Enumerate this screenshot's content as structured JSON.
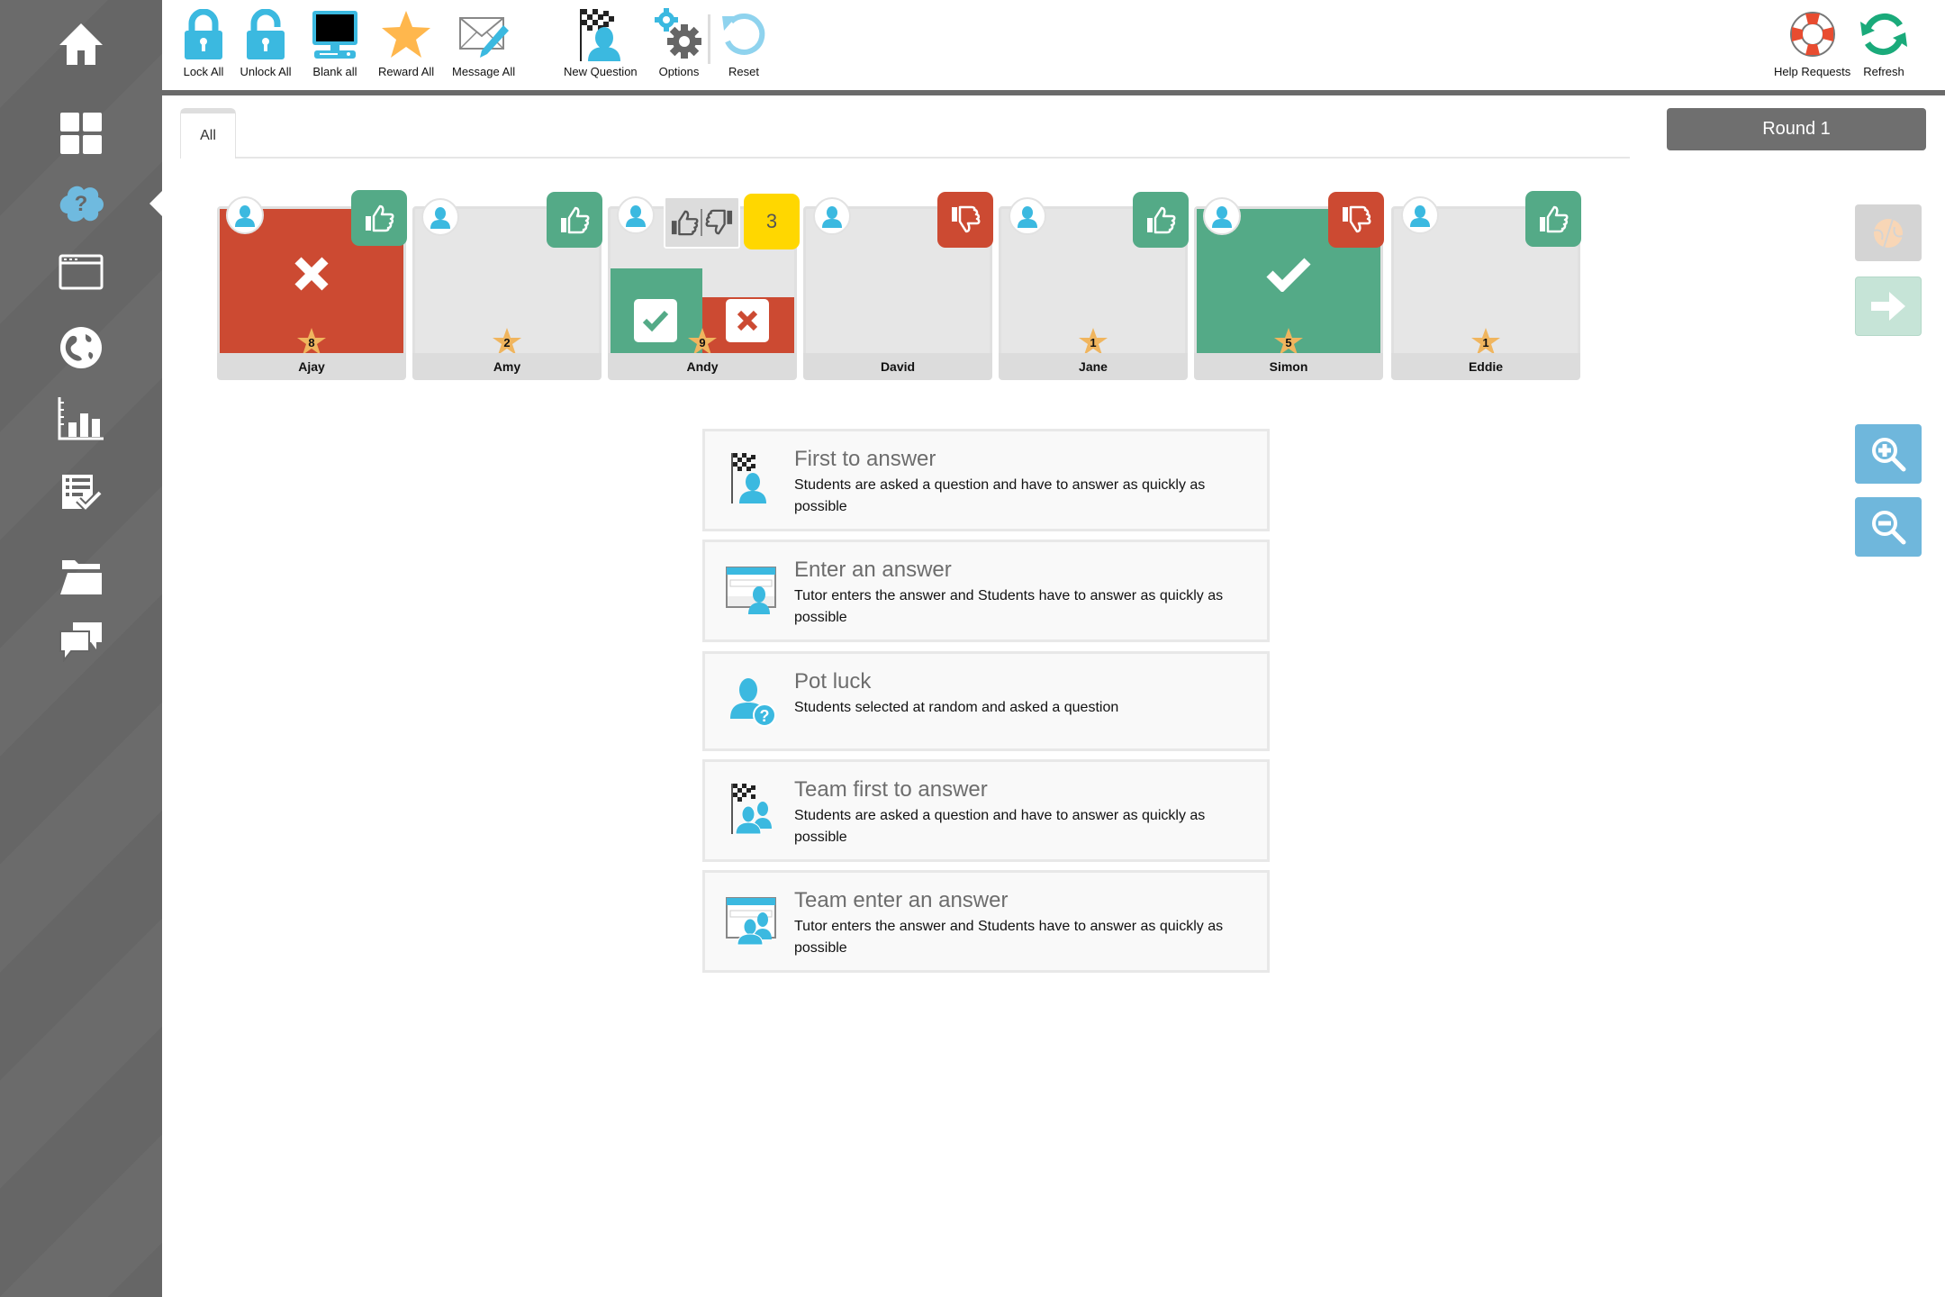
{
  "sidebar": {
    "items": [
      {
        "id": "home",
        "icon": "home-icon"
      },
      {
        "id": "dashboard",
        "icon": "grid-icon"
      },
      {
        "id": "questions",
        "icon": "question-cloud-icon",
        "active": true
      },
      {
        "id": "window",
        "icon": "browser-window-icon"
      },
      {
        "id": "web",
        "icon": "globe-icon"
      },
      {
        "id": "reports",
        "icon": "bar-chart-icon"
      },
      {
        "id": "tests",
        "icon": "checklist-icon"
      },
      {
        "id": "files",
        "icon": "folder-open-icon"
      },
      {
        "id": "chat",
        "icon": "chat-bubbles-icon"
      }
    ]
  },
  "toolbar": {
    "lock_all": "Lock All",
    "unlock_all": "Unlock All",
    "blank_all": "Blank all",
    "reward_all": "Reward All",
    "message_all": "Message All",
    "new_question": "New Question",
    "options": "Options",
    "reset": "Reset",
    "help_requests": "Help Requests",
    "refresh": "Refresh"
  },
  "tabs": [
    {
      "label": "All",
      "active": true
    }
  ],
  "round_label": "Round 1",
  "students": [
    {
      "name": "Ajay",
      "stars": "8",
      "state": "wrong",
      "feedback": "thumbs-up"
    },
    {
      "name": "Amy",
      "stars": "2",
      "state": "none",
      "feedback": "thumbs-up"
    },
    {
      "name": "Andy",
      "stars": "9",
      "state": "marking",
      "feedback": "thumbs-up-down",
      "answer_order": "3"
    },
    {
      "name": "David",
      "stars": "",
      "state": "none",
      "feedback": "thumbs-down"
    },
    {
      "name": "Jane",
      "stars": "1",
      "state": "none",
      "feedback": "thumbs-up"
    },
    {
      "name": "Simon",
      "stars": "5",
      "state": "correct",
      "feedback": "thumbs-down"
    },
    {
      "name": "Eddie",
      "stars": "1",
      "state": "none",
      "feedback": "thumbs-up"
    }
  ],
  "question_types": [
    {
      "title": "First to answer",
      "description": "Students are asked a question and have to answer as quickly as possible",
      "icon": "checkered-flag-student-icon"
    },
    {
      "title": "Enter an answer",
      "description": "Tutor enters the answer and Students have to answer as quickly as possible",
      "icon": "window-student-icon"
    },
    {
      "title": "Pot luck",
      "description": "Students selected at random and asked a question",
      "icon": "student-question-icon"
    },
    {
      "title": "Team first to answer",
      "description": "Students are asked a question and have to answer as quickly as possible",
      "icon": "checkered-flag-team-icon"
    },
    {
      "title": "Team enter an answer",
      "description": "Tutor enters the answer and Students have to answer as quickly as possible",
      "icon": "window-team-icon"
    }
  ],
  "colors": {
    "accent_blue": "#3bb9e0",
    "correct_green": "#54aa87",
    "wrong_red": "#cc4a32",
    "answer_order_yellow": "#ffd700",
    "star_gold": "#f0b55e",
    "sidebar_gray": "#666666"
  }
}
